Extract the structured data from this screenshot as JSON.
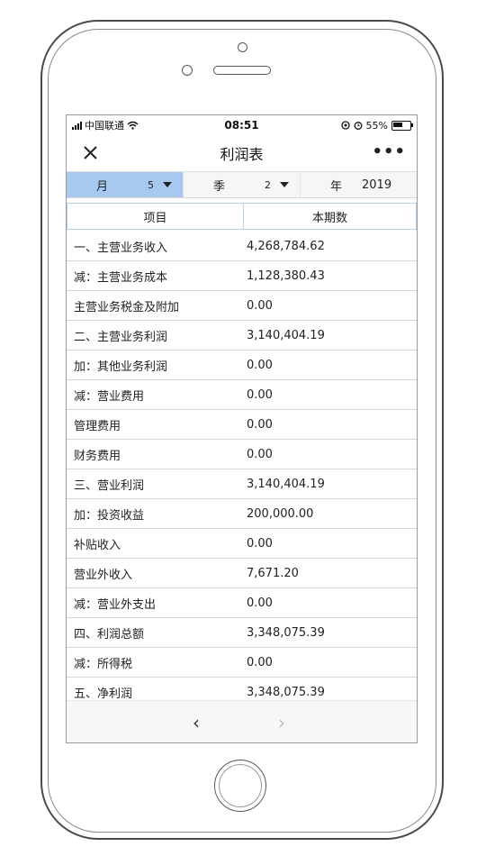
{
  "status": {
    "carrier": "中国联通",
    "time": "08:51",
    "battery": "55%"
  },
  "navbar": {
    "title": "利润表",
    "more": "•••"
  },
  "filters": {
    "month_label": "月",
    "month_value": "5",
    "quarter_label": "季",
    "quarter_value": "2",
    "year_label": "年",
    "year_value": "2019"
  },
  "table": {
    "headers": [
      "项目",
      "本期数"
    ],
    "rows": [
      {
        "name": "一、主营业务收入",
        "amount": "4,268,784.62"
      },
      {
        "name": "减：主营业务成本",
        "amount": "1,128,380.43"
      },
      {
        "name": "主营业务税金及附加",
        "amount": "0.00"
      },
      {
        "name": "二、主营业务利润",
        "amount": "3,140,404.19"
      },
      {
        "name": "加：其他业务利润",
        "amount": "0.00"
      },
      {
        "name": "减：营业费用",
        "amount": "0.00"
      },
      {
        "name": "管理费用",
        "amount": "0.00"
      },
      {
        "name": "财务费用",
        "amount": "0.00"
      },
      {
        "name": "三、营业利润",
        "amount": "3,140,404.19"
      },
      {
        "name": "加：投资收益",
        "amount": "200,000.00"
      },
      {
        "name": "补贴收入",
        "amount": "0.00"
      },
      {
        "name": "营业外收入",
        "amount": "7,671.20"
      },
      {
        "name": "减：营业外支出",
        "amount": "0.00"
      },
      {
        "name": "四、利润总额",
        "amount": "3,348,075.39"
      },
      {
        "name": "减：所得税",
        "amount": "0.00"
      },
      {
        "name": "五、净利润",
        "amount": "3,348,075.39"
      }
    ]
  },
  "pager": {
    "prev": "‹",
    "next": "›"
  },
  "colors": {
    "active_filter": "#a7c9f0",
    "header_border": "#b7d1ea"
  }
}
